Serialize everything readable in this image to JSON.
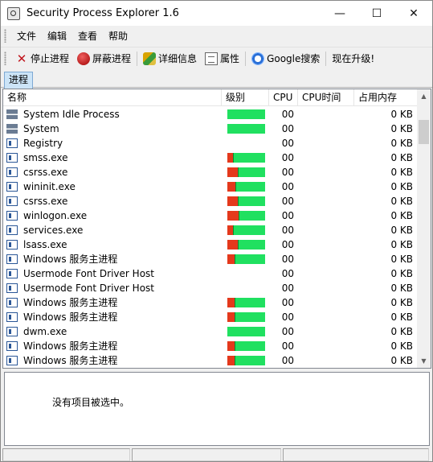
{
  "window": {
    "title": "Security Process Explorer 1.6",
    "controls": {
      "minimize": "—",
      "maximize": "☐",
      "close": "✕"
    }
  },
  "menu": [
    {
      "label": "文件"
    },
    {
      "label": "编辑"
    },
    {
      "label": "查看"
    },
    {
      "label": "帮助"
    }
  ],
  "toolbar": {
    "stop": "停止进程",
    "block": "屏蔽进程",
    "details": "详细信息",
    "properties": "属性",
    "google": "Google搜索",
    "upgrade": "现在升级!"
  },
  "tabs": [
    {
      "label": "进程",
      "active": true
    }
  ],
  "columns": {
    "name": "名称",
    "level": "级别",
    "cpu": "CPU",
    "cpu_time": "CPU时间",
    "memory": "占用内存"
  },
  "rows": [
    {
      "name": "System Idle Process",
      "icon": "system-icon",
      "level": 0,
      "cpu": "00",
      "mem": "0 KB"
    },
    {
      "name": "System",
      "icon": "system-icon",
      "level": 0,
      "cpu": "00",
      "mem": "0 KB"
    },
    {
      "name": "Registry",
      "icon": "process-icon",
      "level": null,
      "cpu": "00",
      "mem": "0 KB"
    },
    {
      "name": "smss.exe",
      "icon": "process-icon",
      "level": 0.15,
      "cpu": "00",
      "mem": "0 KB"
    },
    {
      "name": "csrss.exe",
      "icon": "process-icon",
      "level": 0.28,
      "cpu": "00",
      "mem": "0 KB"
    },
    {
      "name": "wininit.exe",
      "icon": "process-icon",
      "level": 0.22,
      "cpu": "00",
      "mem": "0 KB"
    },
    {
      "name": "csrss.exe",
      "icon": "process-icon",
      "level": 0.28,
      "cpu": "00",
      "mem": "0 KB"
    },
    {
      "name": "winlogon.exe",
      "icon": "process-icon",
      "level": 0.3,
      "cpu": "00",
      "mem": "0 KB"
    },
    {
      "name": "services.exe",
      "icon": "process-icon",
      "level": 0.15,
      "cpu": "00",
      "mem": "0 KB"
    },
    {
      "name": "lsass.exe",
      "icon": "process-icon",
      "level": 0.28,
      "cpu": "00",
      "mem": "0 KB"
    },
    {
      "name": "Windows 服务主进程",
      "icon": "process-icon",
      "level": 0.2,
      "cpu": "00",
      "mem": "0 KB"
    },
    {
      "name": "Usermode Font Driver Host",
      "icon": "process-icon",
      "level": null,
      "cpu": "00",
      "mem": "0 KB"
    },
    {
      "name": "Usermode Font Driver Host",
      "icon": "process-icon",
      "level": null,
      "cpu": "00",
      "mem": "0 KB"
    },
    {
      "name": "Windows 服务主进程",
      "icon": "process-icon",
      "level": 0.2,
      "cpu": "00",
      "mem": "0 KB"
    },
    {
      "name": "Windows 服务主进程",
      "icon": "process-icon",
      "level": 0.2,
      "cpu": "00",
      "mem": "0 KB"
    },
    {
      "name": "dwm.exe",
      "icon": "process-icon",
      "level": 0,
      "cpu": "00",
      "mem": "0 KB"
    },
    {
      "name": "Windows 服务主进程",
      "icon": "process-icon",
      "level": 0.2,
      "cpu": "00",
      "mem": "0 KB"
    },
    {
      "name": "Windows 服务主进程",
      "icon": "process-icon",
      "level": 0.2,
      "cpu": "00",
      "mem": "0 KB"
    }
  ],
  "detail": {
    "empty_text": "没有项目被选中。"
  },
  "colors": {
    "level_safe": "#20e060",
    "level_risk": "#e4391c",
    "tab_active": "#cce4f7"
  }
}
